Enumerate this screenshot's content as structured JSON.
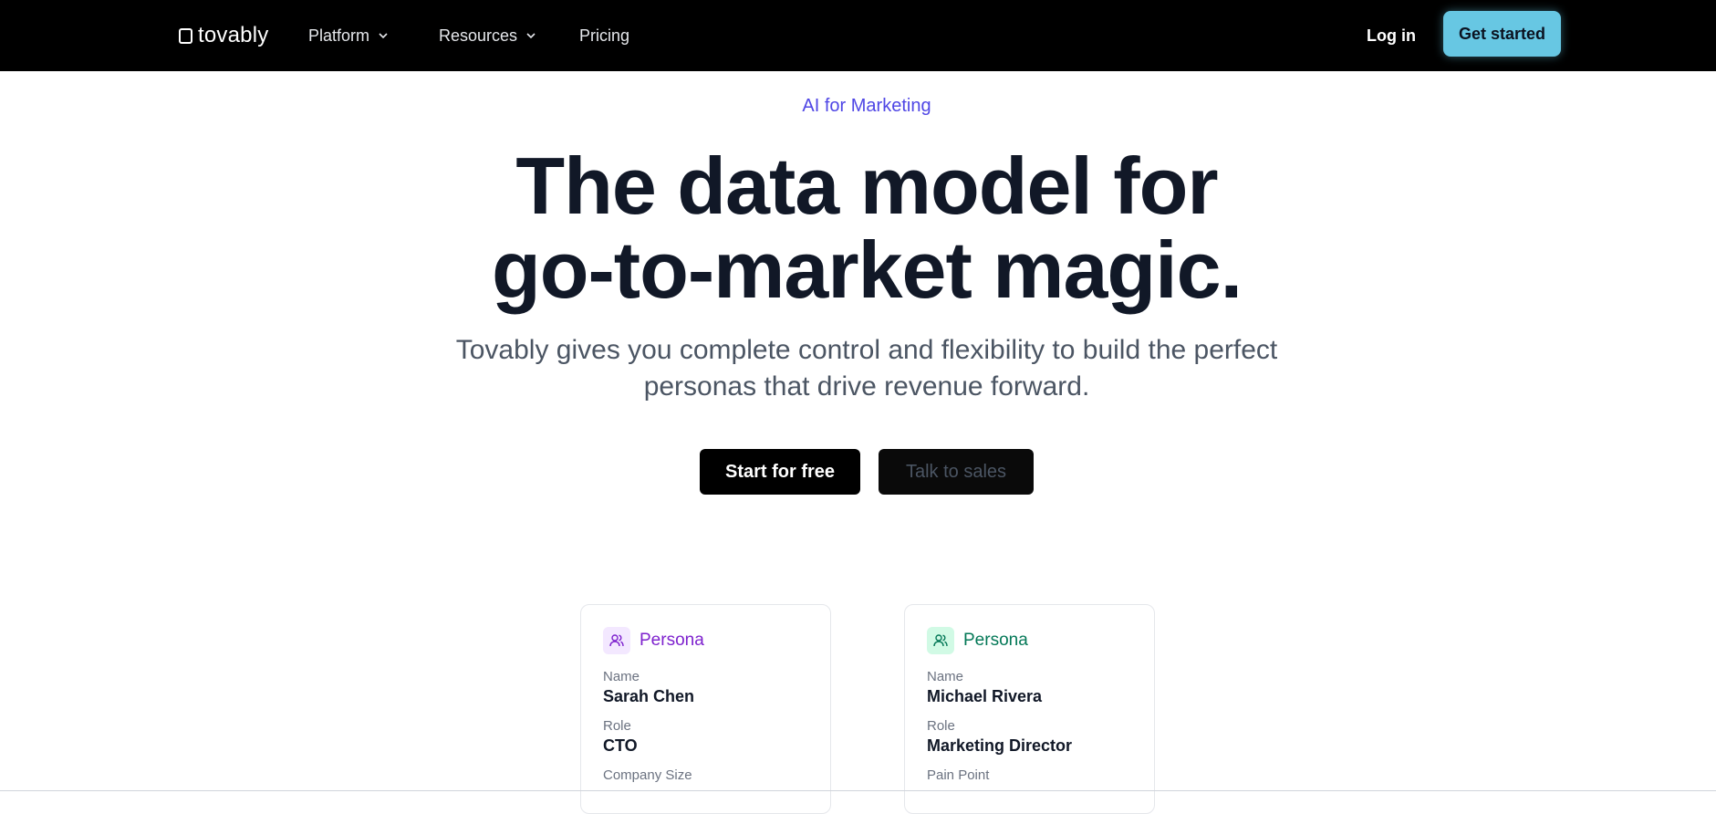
{
  "nav": {
    "logo": "tovably",
    "items": [
      {
        "label": "Platform"
      },
      {
        "label": "Resources"
      },
      {
        "label": "Pricing"
      }
    ],
    "login": "Log in",
    "get_started": "Get started"
  },
  "hero": {
    "eyebrow": "AI for Marketing",
    "title_line1": "The data model for",
    "title_line2": "go-to-market magic.",
    "subtitle_line1": "Tovably gives you complete control and flexibility to build the perfect",
    "subtitle_line2": "personas that drive revenue forward.",
    "primary_cta": "Start for free",
    "secondary_cta": "Talk to sales"
  },
  "cards": [
    {
      "title": "Persona",
      "accent": "#7e22ce",
      "badge_bg": "#f3e8ff",
      "icon": "users-icon",
      "fields": [
        {
          "label": "Name",
          "value": "Sarah Chen"
        },
        {
          "label": "Role",
          "value": "CTO"
        },
        {
          "label": "Company Size",
          "value": ""
        }
      ]
    },
    {
      "title": "Persona",
      "accent": "#047857",
      "badge_bg": "#d1fae5",
      "icon": "users-icon",
      "fields": [
        {
          "label": "Name",
          "value": "Michael Rivera"
        },
        {
          "label": "Role",
          "value": "Marketing Director"
        },
        {
          "label": "Pain Point",
          "value": ""
        }
      ]
    }
  ],
  "colors": {
    "nav_bg": "#000000",
    "cta_accent": "#67c7e3",
    "eyebrow": "#4f46e5"
  }
}
